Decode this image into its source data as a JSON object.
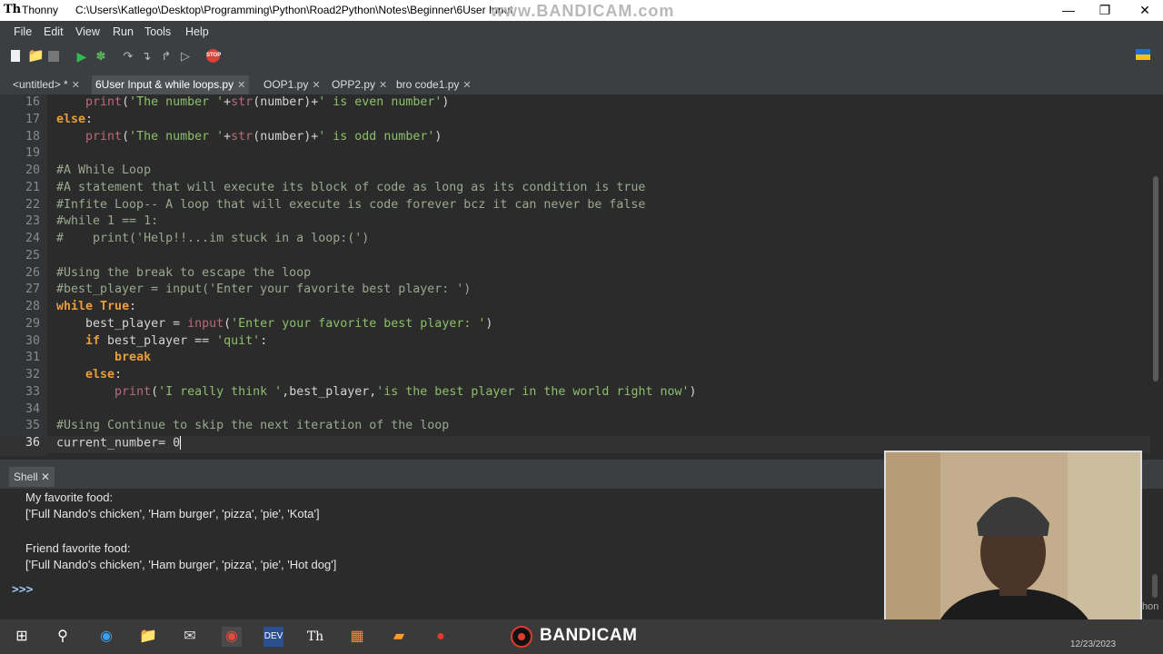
{
  "window": {
    "app_name": "Thonny",
    "title_path": "C:\\Users\\Katlego\\Desktop\\Programming\\Python\\Road2Python\\Notes\\Beginner\\6User Input",
    "watermark": "www.BANDICAM.com"
  },
  "menu": [
    "File",
    "Edit",
    "View",
    "Run",
    "Tools",
    "Help"
  ],
  "tabs": [
    {
      "label": "<untitled> *",
      "active": false
    },
    {
      "label": "6User Input & while loops.py",
      "active": true
    },
    {
      "label": "OOP1.py",
      "active": false
    },
    {
      "label": "OPP2.py",
      "active": false
    },
    {
      "label": "bro code1.py",
      "active": false
    }
  ],
  "editor": {
    "current_line": 36,
    "lines": [
      {
        "n": "16",
        "t": "    print('The number '+str(number)+' is even number')"
      },
      {
        "n": "17",
        "t": "else:"
      },
      {
        "n": "18",
        "t": "    print('The number '+str(number)+' is odd number')"
      },
      {
        "n": "19",
        "t": ""
      },
      {
        "n": "20",
        "t": "#A While Loop"
      },
      {
        "n": "21",
        "t": "#A statement that will execute its block of code as long as its condition is true"
      },
      {
        "n": "22",
        "t": "#Infite Loop-- A loop that will execute is code forever bcz it can never be false"
      },
      {
        "n": "23",
        "t": "#while 1 == 1:"
      },
      {
        "n": "24",
        "t": "#    print('Help!!...im stuck in a loop:(')"
      },
      {
        "n": "25",
        "t": ""
      },
      {
        "n": "26",
        "t": "#Using the break to escape the loop"
      },
      {
        "n": "27",
        "t": "#best_player = input('Enter your favorite best player: ')"
      },
      {
        "n": "28",
        "t": "while True:"
      },
      {
        "n": "29",
        "t": "    best_player = input('Enter your favorite best player: ')"
      },
      {
        "n": "30",
        "t": "    if best_player == 'quit':"
      },
      {
        "n": "31",
        "t": "        break"
      },
      {
        "n": "32",
        "t": "    else:"
      },
      {
        "n": "33",
        "t": "        print('I really think ',best_player,'is the best player in the world right now')"
      },
      {
        "n": "34",
        "t": ""
      },
      {
        "n": "35",
        "t": "#Using Continue to skip the next iteration of the loop"
      },
      {
        "n": "36",
        "t": "current_number= 0"
      }
    ]
  },
  "shell": {
    "tab_label": "Shell",
    "output": [
      "My favorite food:",
      "['Full Nando's chicken', 'Ham burger', 'pizza', 'pie', 'Kota']",
      "",
      "Friend favorite food:",
      "['Full Nando's chicken', 'Ham burger', 'pizza', 'pie', 'Hot dog']"
    ],
    "prompt": ">>>",
    "edge_text": "hon"
  },
  "taskbar": {
    "recorder_label": "BANDICAM",
    "date": "12/23/2023"
  },
  "colors": {
    "editor_bg": "#2b2b2b",
    "keyword": "#e79d3b",
    "string": "#8dbf6a",
    "builtin": "#b96a7b",
    "comment": "#9aa88f"
  }
}
